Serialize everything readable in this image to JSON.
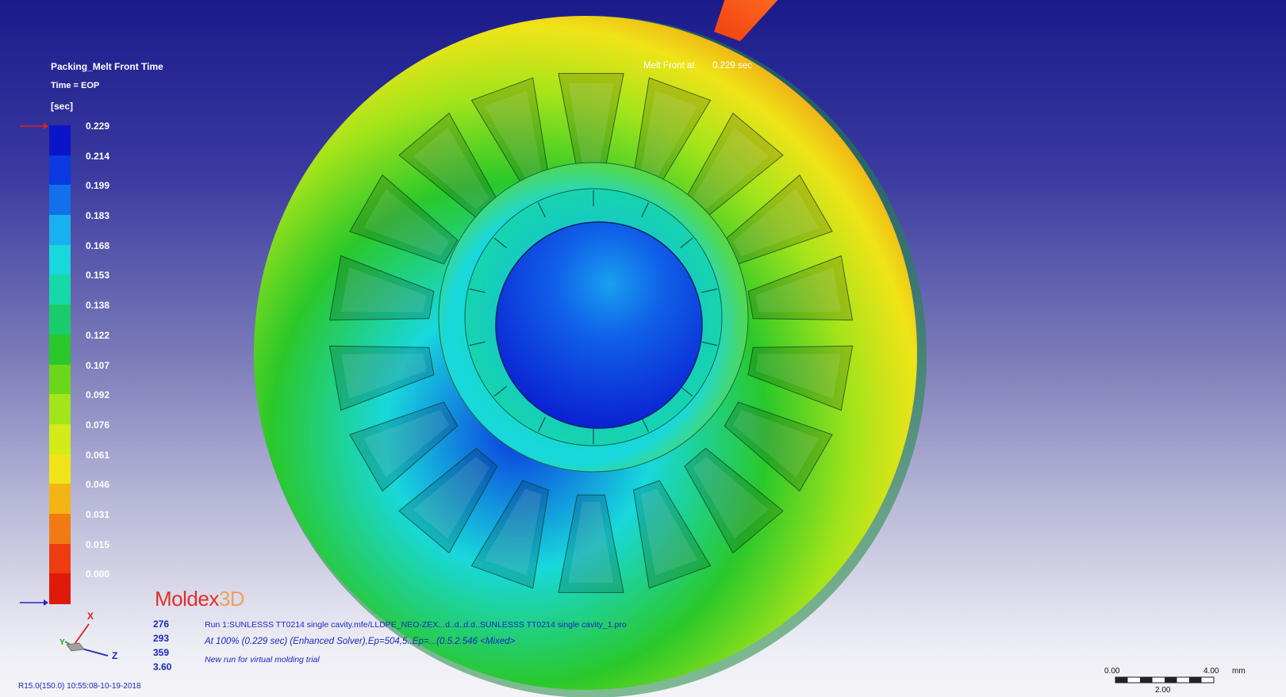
{
  "legend": {
    "title": "Packing_Melt Front Time",
    "time": "Time = EOP",
    "unit": "[sec]",
    "ticks": [
      "0.229",
      "0.214",
      "0.199",
      "0.183",
      "0.168",
      "0.153",
      "0.138",
      "0.122",
      "0.107",
      "0.092",
      "0.076",
      "0.061",
      "0.046",
      "0.031",
      "0.015",
      "0.000"
    ],
    "colors": [
      "#0a14c8",
      "#0a3ae0",
      "#1270ea",
      "#18b0ee",
      "#18d8dc",
      "#16d8a8",
      "#18cc6a",
      "#2ac82a",
      "#6ad81a",
      "#a4e41a",
      "#d2ec18",
      "#f0e418",
      "#f4b414",
      "#f27a12",
      "#ec3c10",
      "#e01a0a"
    ]
  },
  "melt_front": {
    "label": "Melt Front at",
    "value": "0.229 sec"
  },
  "brand": {
    "name": "Moldex",
    "suffix": "3D"
  },
  "stats": [
    "276",
    "293",
    "359",
    "3.60"
  ],
  "run_info": {
    "line1": "Run 1:SUNLESSS TT0214 single cavity.mfe/LLDPE_NEO-ZEX...d..d..d.d..SUNLESSS TT0214 single cavity_1.pro",
    "line2": "At 100% (0.229 sec) (Enhanced Solver),Ep=504,5..Ep=...(0.5.2.546  <Mixed>",
    "line3": "New run for virtual molding trial"
  },
  "version": "R15.0(150.0) 10:55:08-10-19-2018",
  "axes": {
    "x": "X",
    "y": "Y",
    "z": "Z"
  },
  "scale_bar": {
    "start": "0.00",
    "end": "4.00",
    "mid": "2.00",
    "unit": "mm"
  },
  "colors": {
    "accent_blue": "#1a28c0",
    "brand_red": "#e0302a"
  }
}
